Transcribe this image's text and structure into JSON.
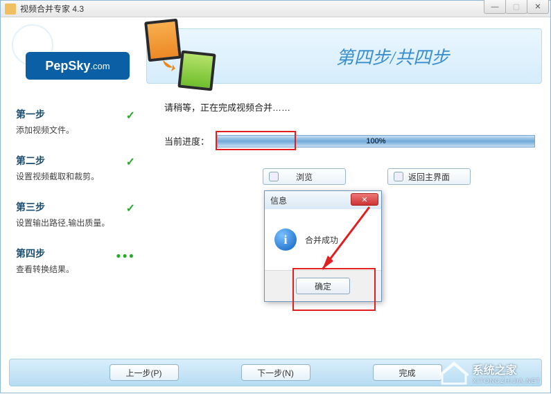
{
  "window": {
    "title": "视频合并专家 4.3"
  },
  "logo": {
    "brand": "PepSky",
    "suffix": ".com"
  },
  "header": {
    "step_banner": "第四步/共四步"
  },
  "sidebar": {
    "steps": [
      {
        "title": "第一步",
        "desc": "添加视频文件。",
        "status": "done"
      },
      {
        "title": "第二步",
        "desc": "设置视频截取和裁剪。",
        "status": "done"
      },
      {
        "title": "第三步",
        "desc": "设置输出路径,输出质量。",
        "status": "done"
      },
      {
        "title": "第四步",
        "desc": "查看转换结果。",
        "status": "current"
      }
    ]
  },
  "main": {
    "status_text": "请稍等，正在完成视频合并……",
    "progress_label": "当前进度：",
    "progress_percent": "100%",
    "browse_btn": "浏览",
    "return_btn": "返回主界面"
  },
  "dialog": {
    "title": "信息",
    "message": "合并成功",
    "ok": "确定"
  },
  "nav": {
    "prev": "上一步(P)",
    "next": "下一步(N)",
    "finish": "完成"
  },
  "watermark": {
    "text": "系统之家",
    "sub": "XITONGZHIJIA.NET"
  }
}
